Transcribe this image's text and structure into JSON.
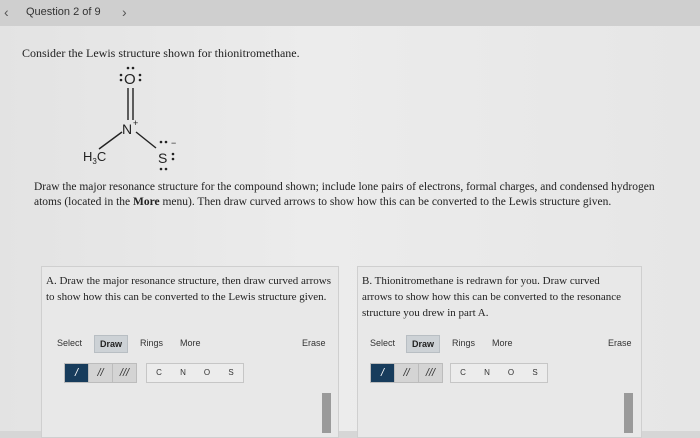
{
  "header": {
    "question_label": "Question 2 of 9",
    "prev_icon": "chevron-left-icon",
    "next_icon": "chevron-right-icon"
  },
  "prompt": "Consider the Lewis structure shown for thionitromethane.",
  "molecule": {
    "methyl": "H",
    "methyl_sub": "3",
    "methyl_c": "C",
    "nitrogen": "N",
    "nitrogen_charge": "+",
    "oxygen": "O",
    "sulfur": "S",
    "sulfur_charge": "−"
  },
  "instructions": {
    "part1": "Draw the major resonance structure for the compound shown; include lone pairs of electrons, formal charges, and condensed hydrogen atoms (located in the ",
    "more": "More",
    "part2": " menu). Then draw curved arrows to show how this can be converted to the Lewis structure given."
  },
  "panel_a": {
    "text": "A. Draw the major resonance structure, then draw curved arrows to show how this can be converted to the Lewis structure given.",
    "toolbar": {
      "select": "Select",
      "draw": "Draw",
      "rings": "Rings",
      "more": "More",
      "erase": "Erase"
    },
    "bonds": [
      "/",
      "//",
      "///"
    ],
    "atoms": [
      "C",
      "N",
      "O",
      "S"
    ]
  },
  "panel_b": {
    "text": "B. Thionitromethane is redrawn for you. Draw curved arrows to show how this can be converted to the resonance structure you drew in part A.",
    "toolbar": {
      "select": "Select",
      "draw": "Draw",
      "rings": "Rings",
      "more": "More",
      "erase": "Erase"
    },
    "bonds": [
      "/",
      "//",
      "///"
    ],
    "atoms": [
      "C",
      "N",
      "O",
      "S"
    ]
  },
  "colors": {
    "active_tool": "#173c5c",
    "background": "#e6e6e6"
  }
}
